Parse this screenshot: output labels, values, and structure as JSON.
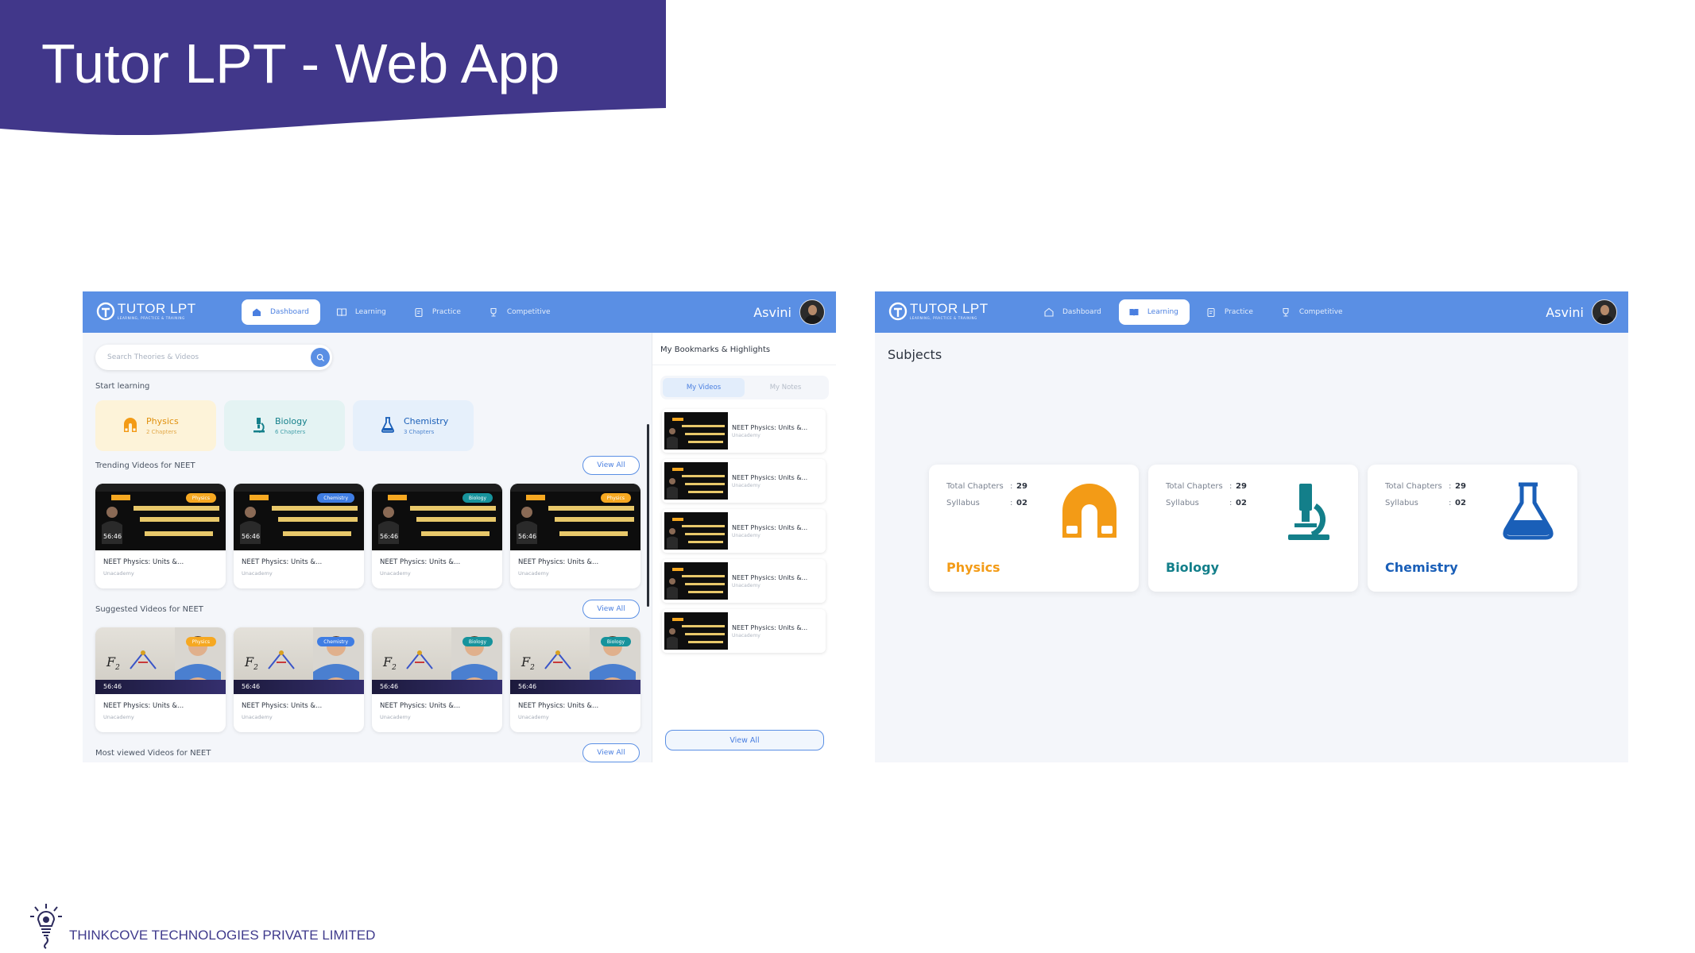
{
  "slide": {
    "title": "Tutor LPT - Web App",
    "company": "THINKCOVE TECHNOLOGIES PRIVATE LIMITED",
    "colors": {
      "banner": "#41378a",
      "nav": "#5a8fe4",
      "physics": "#f39b16",
      "biology": "#137f8a",
      "chemistry": "#1a5fb8"
    }
  },
  "app": {
    "logo_name": "TUTOR LPT",
    "logo_tagline": "LEARNING, PRACTICE & TRAINING",
    "nav": [
      {
        "label": "Dashboard",
        "icon": "home-icon"
      },
      {
        "label": "Learning",
        "icon": "book-icon"
      },
      {
        "label": "Practice",
        "icon": "clipboard-icon"
      },
      {
        "label": "Competitive",
        "icon": "trophy-icon"
      }
    ],
    "user_name": "Asvini"
  },
  "dashboard": {
    "active_tab": "Dashboard",
    "search_placeholder": "Search Theories & Videos",
    "start_learning_label": "Start learning",
    "subjects": [
      {
        "name": "Physics",
        "chapters": "2 Chapters"
      },
      {
        "name": "Biology",
        "chapters": "6 Chapters"
      },
      {
        "name": "Chemistry",
        "chapters": "3 Chapters"
      }
    ],
    "trending_title": "Trending Videos for NEET",
    "suggested_title": "Suggested Videos for NEET",
    "most_viewed_title": "Most viewed Videos for NEET",
    "view_all": "View All",
    "trending_videos": [
      {
        "title": "NEET Physics: Units &...",
        "source": "Unacademy",
        "duration": "56:46",
        "tag": "Physics"
      },
      {
        "title": "NEET Physics: Units &...",
        "source": "Unacademy",
        "duration": "56:46",
        "tag": "Chemistry"
      },
      {
        "title": "NEET Physics: Units &...",
        "source": "Unacademy",
        "duration": "56:46",
        "tag": "Biology"
      },
      {
        "title": "NEET Physics: Units &...",
        "source": "Unacademy",
        "duration": "56:46",
        "tag": "Physics"
      }
    ],
    "suggested_videos": [
      {
        "title": "NEET Physics: Units &...",
        "source": "Unacademy",
        "duration": "56:46",
        "tag": "Physics"
      },
      {
        "title": "NEET Physics: Units &...",
        "source": "Unacademy",
        "duration": "56:46",
        "tag": "Chemistry"
      },
      {
        "title": "NEET Physics: Units &...",
        "source": "Unacademy",
        "duration": "56:46",
        "tag": "Biology"
      },
      {
        "title": "NEET Physics: Units &...",
        "source": "Unacademy",
        "duration": "56:46",
        "tag": "Biology"
      }
    ],
    "bookmarks": {
      "title": "My Bookmarks & Highlights",
      "tabs": [
        "My Videos",
        "My Notes"
      ],
      "active_tab": "My Videos",
      "items": [
        {
          "title": "NEET Physics: Units &...",
          "source": "Unacademy"
        },
        {
          "title": "NEET Physics: Units &...",
          "source": "Unacademy"
        },
        {
          "title": "NEET Physics: Units &...",
          "source": "Unacademy"
        },
        {
          "title": "NEET Physics: Units &...",
          "source": "Unacademy"
        },
        {
          "title": "NEET Physics: Units &...",
          "source": "Unacademy"
        }
      ],
      "view_all": "View All"
    }
  },
  "learning": {
    "active_tab": "Learning",
    "subjects_title": "Subjects",
    "total_chapters_label": "Total Chapters",
    "syllabus_label": "Syllabus",
    "colon": ":",
    "cards": [
      {
        "name": "Physics",
        "total_chapters": "29",
        "syllabus": "02",
        "icon": "magnet-icon"
      },
      {
        "name": "Biology",
        "total_chapters": "29",
        "syllabus": "02",
        "icon": "microscope-icon"
      },
      {
        "name": "Chemistry",
        "total_chapters": "29",
        "syllabus": "02",
        "icon": "flask-icon"
      }
    ]
  }
}
